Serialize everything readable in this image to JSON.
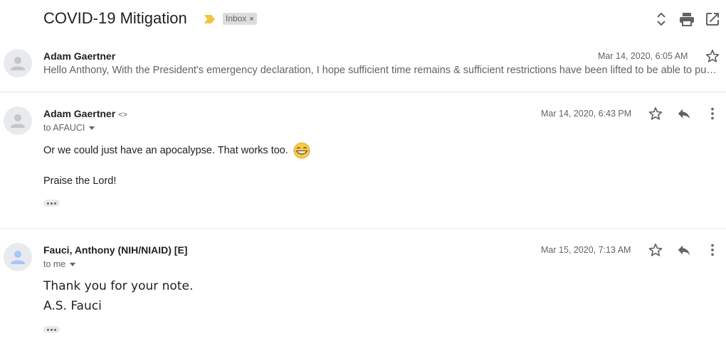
{
  "thread": {
    "subject": "COVID-19 Mitigation",
    "label_chip": "Inbox",
    "label_remove": "×"
  },
  "icons": {
    "importance": "importance-marker-icon",
    "expand_collapse": "expand-collapse-icon",
    "print": "print-icon",
    "open_new_window": "open-in-new-window-icon",
    "star": "star-outline-icon",
    "reply": "reply-icon",
    "more": "more-vertical-icon",
    "avatar": "default-avatar-icon",
    "emoji": "grinning-tears-emoji-icon"
  },
  "colors": {
    "importance": "#f4c542",
    "avatar_gray": "#c3c6ca",
    "avatar_blue": "#a8c7fa"
  },
  "messages": [
    {
      "sender": "Adam Gaertner",
      "date": "Mar 14, 2020, 6:05 AM",
      "snippet": "Hello Anthony, With the President's emergency declaration, I hope sufficient time remains & sufficient restrictions have been lifted to be able to pursue an approach to mitigation"
    },
    {
      "sender": "Adam Gaertner",
      "email_hint": "<>",
      "date": "Mar 14, 2020, 6:43 PM",
      "to": "to AFAUCI",
      "body_line_1": "Or we could just have an apocalypse. That works too.",
      "body_line_2": "Praise the Lord!"
    },
    {
      "sender": "Fauci, Anthony (NIH/NIAID) [E]",
      "date": "Mar 15, 2020, 7:13 AM",
      "to": "to me",
      "body_line_1": "Thank you for your note.",
      "body_line_2": "A.S. Fauci"
    }
  ]
}
